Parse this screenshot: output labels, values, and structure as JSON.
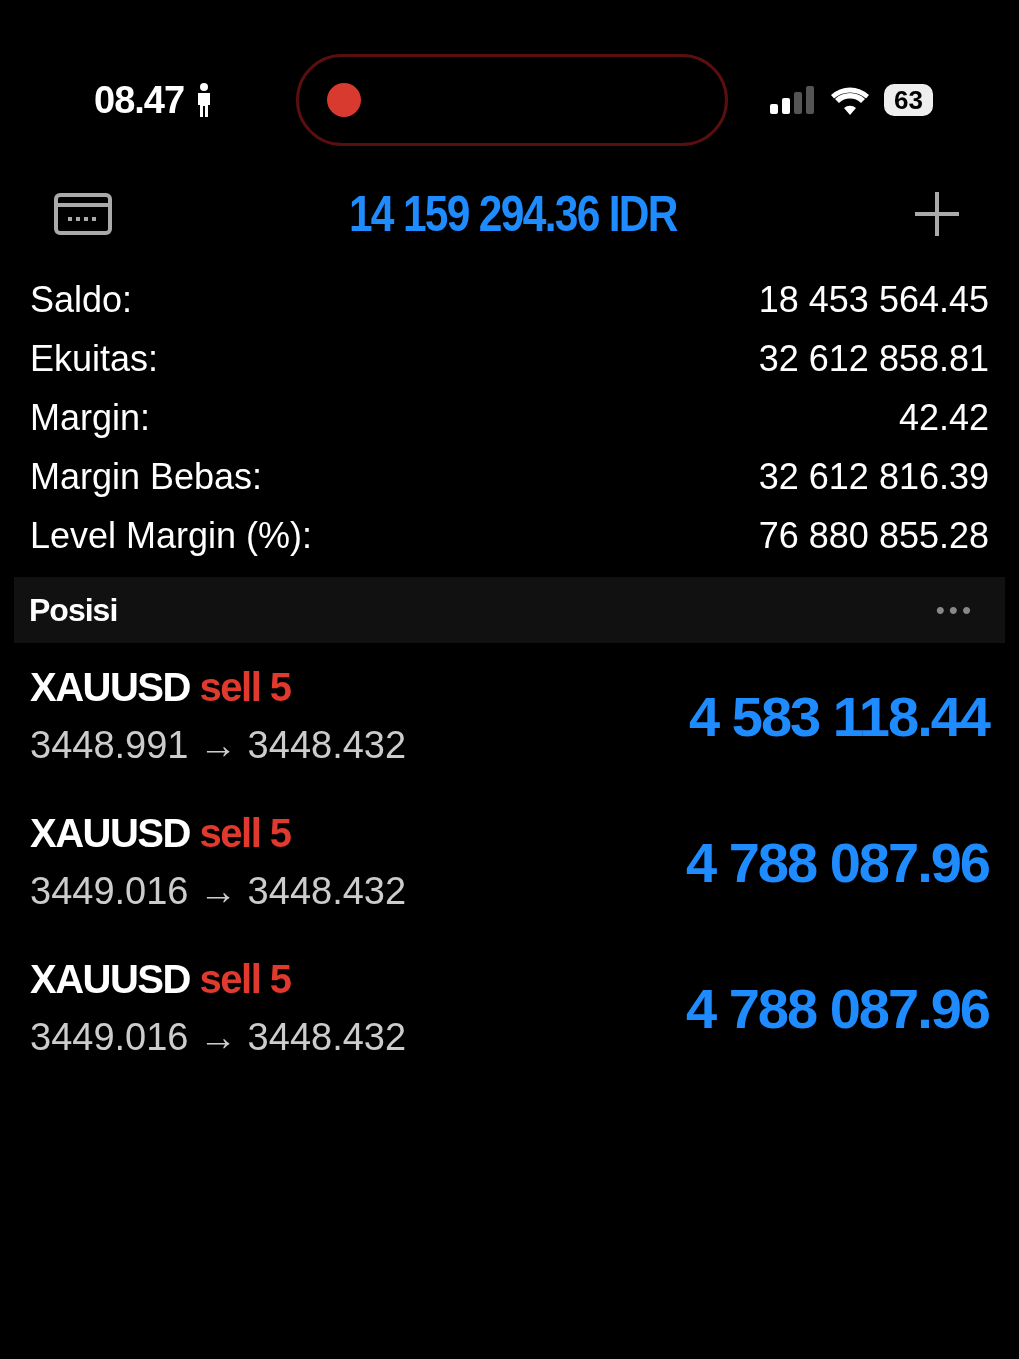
{
  "status_bar": {
    "time": "08.47",
    "battery": "63",
    "recording": true
  },
  "header": {
    "balance": "14 159 294.36 IDR"
  },
  "summary": [
    {
      "label": "Saldo:",
      "value": "18 453 564.45"
    },
    {
      "label": "Ekuitas:",
      "value": "32 612 858.81"
    },
    {
      "label": "Margin:",
      "value": "42.42"
    },
    {
      "label": "Margin Bebas:",
      "value": "32 612 816.39"
    },
    {
      "label": "Level Margin (%):",
      "value": "76 880 855.28"
    }
  ],
  "section": {
    "title": "Posisi",
    "menu": "•••"
  },
  "positions": [
    {
      "symbol": "XAUUSD",
      "side": "sell 5",
      "prices": "3448.991 → 3448.432",
      "profit": "4 583 118.44"
    },
    {
      "symbol": "XAUUSD",
      "side": "sell 5",
      "prices": "3449.016 → 3448.432",
      "profit": "4 788 087.96"
    },
    {
      "symbol": "XAUUSD",
      "side": "sell 5",
      "prices": "3449.016 → 3448.432",
      "profit": "4 788 087.96"
    }
  ]
}
